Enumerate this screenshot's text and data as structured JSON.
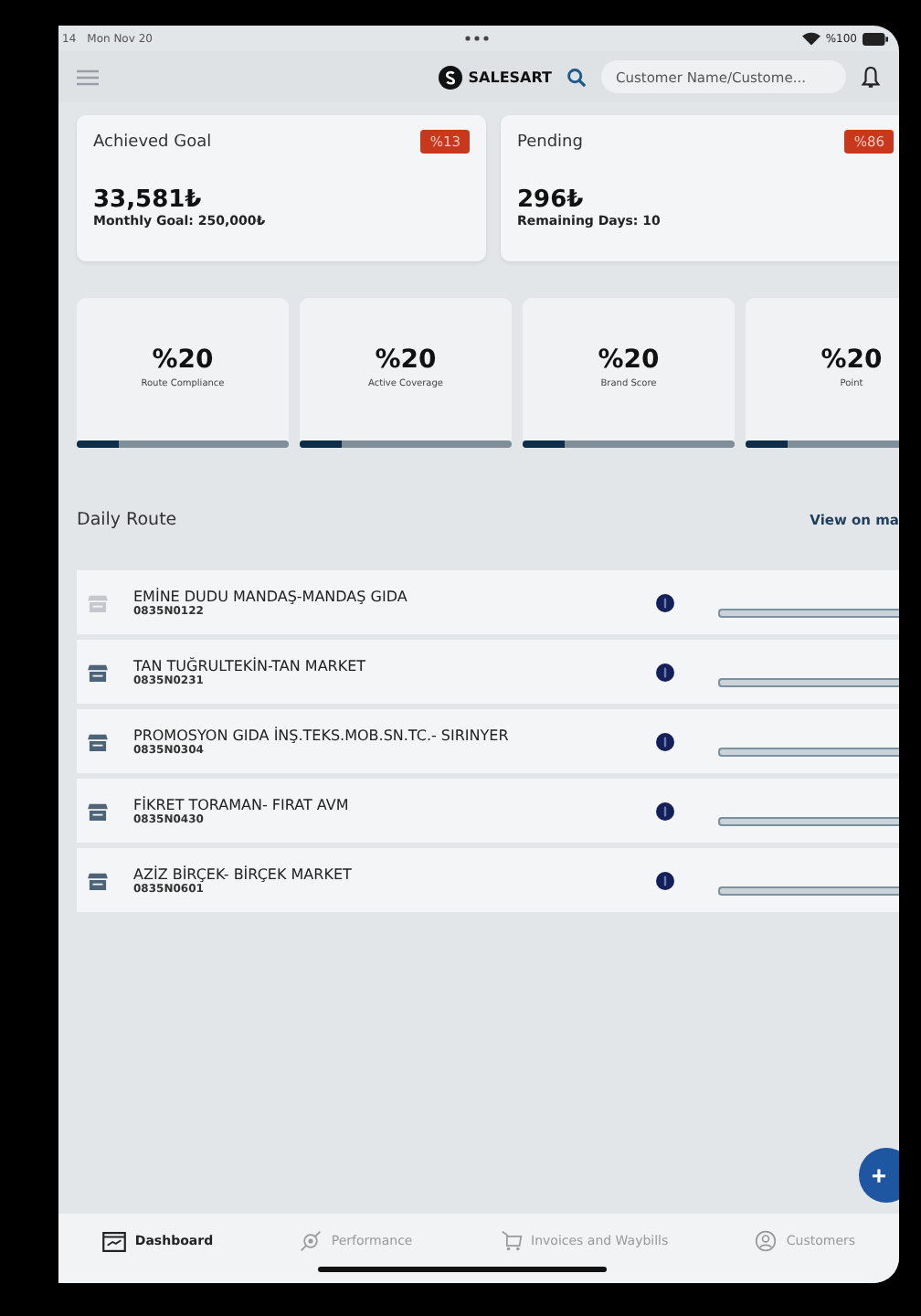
{
  "status_bar": {
    "time": "14",
    "date": "Mon Nov 20",
    "battery": "%100"
  },
  "header": {
    "logo": "SALESART",
    "search": {
      "placeholder": "Customer Name/Custome..."
    }
  },
  "goal_cards": [
    {
      "title": "Achieved Goal",
      "badge": "%13",
      "amount": "33,581₺",
      "subtitle": "Monthly Goal: 250,000₺"
    },
    {
      "title": "Pending",
      "badge": "%86",
      "amount": "296₺",
      "subtitle": "Remaining Days: 10"
    }
  ],
  "kpis": [
    {
      "value": "%20",
      "label": "Route Compliance",
      "level": 0.2
    },
    {
      "value": "%20",
      "label": "Active Coverage",
      "level": 0.2
    },
    {
      "value": "%20",
      "label": "Brand Score",
      "level": 0.2
    },
    {
      "value": "%20",
      "label": "Point",
      "level": 0.2
    }
  ],
  "daily_route": {
    "title": "Daily Route",
    "link": "View on ma",
    "rows": [
      {
        "name": "EMİNE DUDU MANDAŞ-MANDAŞ GIDA",
        "code": "0835N0122",
        "dimmed": true,
        "level": 0
      },
      {
        "name": "TAN TUĞRULTEKİN-TAN MARKET",
        "code": "0835N0231",
        "dimmed": false,
        "level": 0
      },
      {
        "name": "PROMOSYON GIDA İNŞ.TEKS.MOB.SN.TC.- SIRINYER",
        "code": "0835N0304",
        "dimmed": false,
        "level": 0
      },
      {
        "name": "FİKRET TORAMAN- FIRAT AVM",
        "code": "0835N0430",
        "dimmed": false,
        "level": 0
      },
      {
        "name": "AZİZ BİRÇEK- BİRÇEK MARKET",
        "code": "0835N0601",
        "dimmed": false,
        "level": 0
      }
    ]
  },
  "fab": "+",
  "tabs": [
    {
      "kind": "dashboard",
      "label": "Dashboard",
      "selected": true
    },
    {
      "kind": "performance",
      "label": "Performance",
      "selected": false
    },
    {
      "kind": "invoices",
      "label": "Invoices and Waybills",
      "selected": false
    },
    {
      "kind": "customers",
      "label": "Customers",
      "selected": false
    }
  ]
}
